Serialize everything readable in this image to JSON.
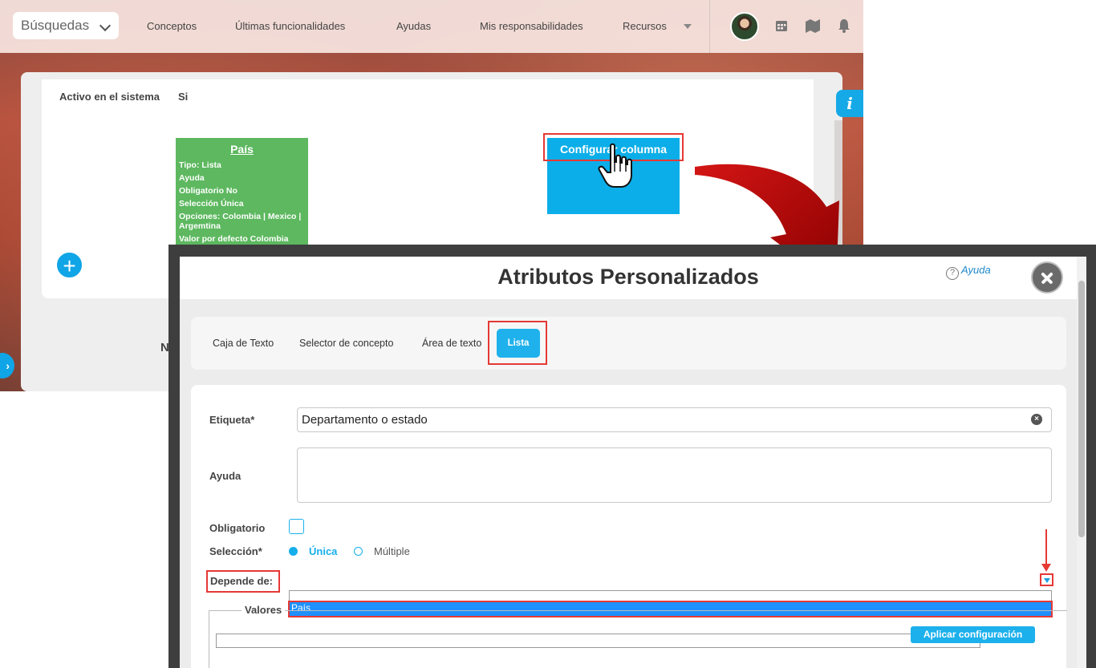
{
  "topbar": {
    "search_select": "Búsquedas",
    "nav": [
      "Conceptos",
      "Últimas funcionalidades",
      "Ayudas",
      "Mis responsabilidades",
      "Recursos"
    ]
  },
  "background": {
    "active_label": "Activo en el sistema",
    "active_value": "Si",
    "green_card": {
      "title": "País",
      "lines": [
        "Tipo: Lista",
        "Ayuda",
        "Obligatorio No",
        "Selección Única",
        "Opciones: Colombia | Mexico | Argemtina",
        "Valor por defecto Colombia"
      ]
    },
    "blue_card_label": "Configurar columna",
    "info_label": "i",
    "plus_label": "+",
    "partial_text": "N"
  },
  "modal": {
    "title": "Atributos Personalizados",
    "help_label": "Ayuda",
    "tabs": [
      "Caja de Texto",
      "Selector de concepto",
      "Área de texto",
      "Lista"
    ],
    "form": {
      "etiqueta_label": "Etiqueta*",
      "etiqueta_value": "Departamento o estado",
      "ayuda_label": "Ayuda",
      "obligatorio_label": "Obligatorio",
      "seleccion_label": "Selección*",
      "seleccion_options": [
        "Única",
        "Múltiple"
      ],
      "depende_label": "Depende de:",
      "depende_option": "País",
      "valores_label": "Valores de",
      "apply_button": "Aplicar configuración"
    }
  },
  "colors": {
    "accent": "#15aeeb",
    "highlight": "#e53935",
    "green_card": "#5db85f",
    "blue_card": "#0baee8"
  }
}
